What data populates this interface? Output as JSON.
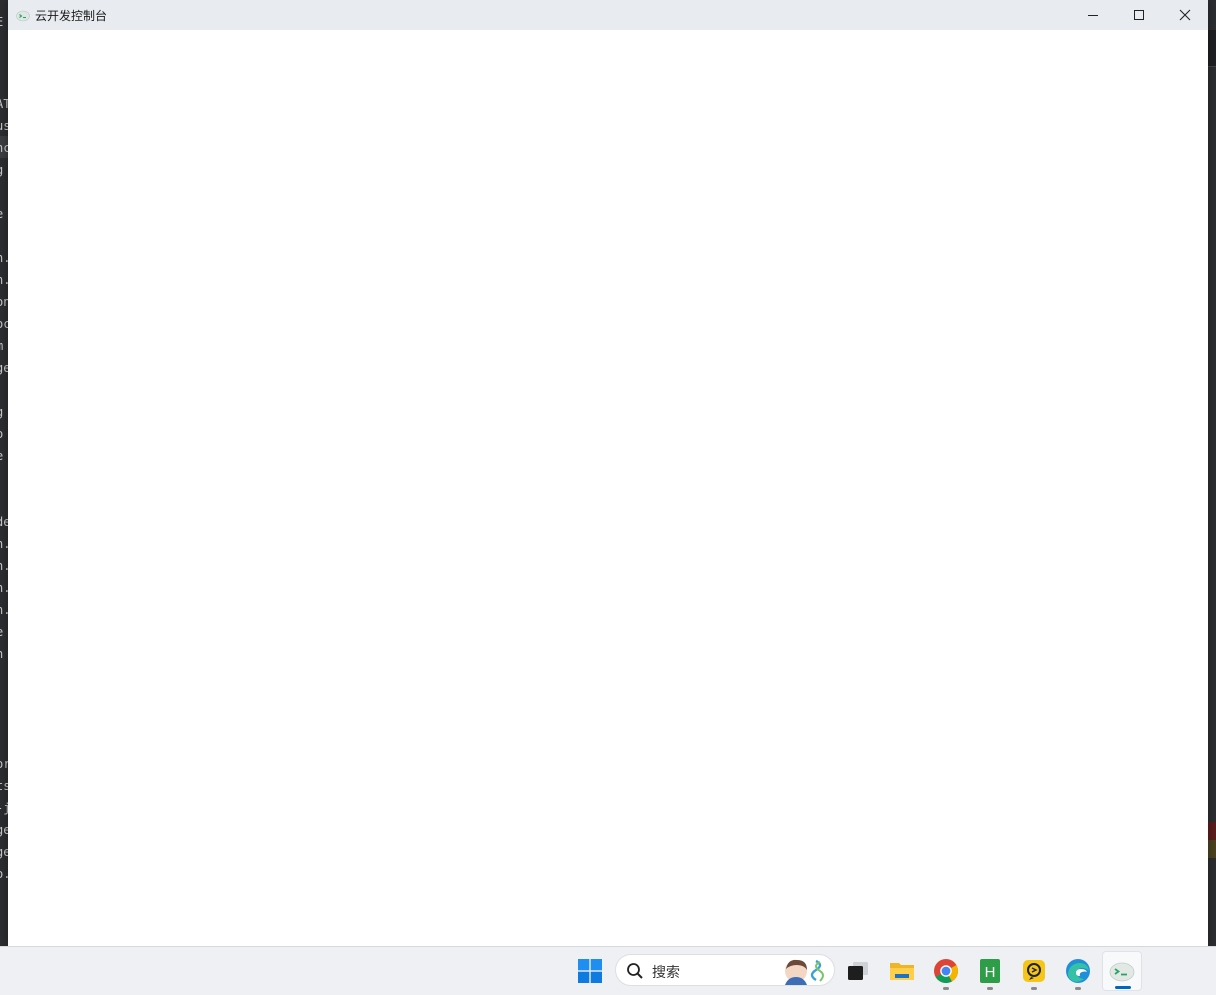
{
  "window": {
    "title": "云开发控制台",
    "controls": {
      "minimize_icon": "minimize-icon",
      "maximize_icon": "maximize-icon",
      "close_icon": "close-icon"
    }
  },
  "background_editor": {
    "fragments": [
      "E",
      "AT",
      "us",
      "nc",
      "g",
      "e",
      "n.",
      "n.",
      "on",
      "oc",
      "m",
      "ge",
      "g",
      "o",
      "e",
      "de",
      "n.",
      "n.",
      "n.",
      "n.",
      "e",
      "h",
      "or",
      "ts",
      "-j",
      "ge",
      "ge",
      "o."
    ]
  },
  "taskbar": {
    "search": {
      "label": "搜索"
    },
    "items": [
      {
        "name": "start-button",
        "icon": "windows-logo-icon"
      },
      {
        "name": "task-view-button",
        "icon": "task-view-icon"
      },
      {
        "name": "file-explorer-button",
        "icon": "folder-icon"
      },
      {
        "name": "chrome-button",
        "icon": "chrome-icon"
      },
      {
        "name": "hbuilder-button",
        "icon": "hbuilder-icon",
        "letter": "H"
      },
      {
        "name": "remote-desktop-button",
        "icon": "remote-icon"
      },
      {
        "name": "edge-button",
        "icon": "edge-icon"
      },
      {
        "name": "cloud-console-button",
        "icon": "cloud-console-icon"
      }
    ]
  },
  "colors": {
    "accent": "#0067c0",
    "titlebar": "#e8ecf0",
    "taskbar": "#eef0f3"
  }
}
